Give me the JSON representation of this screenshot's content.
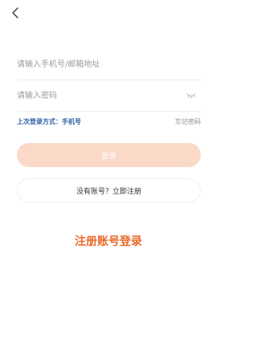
{
  "header": {
    "back_icon": "chevron-left-icon"
  },
  "form": {
    "phone_placeholder": "请输入手机号/邮箱地址",
    "phone_value": "",
    "password_placeholder": "请输入密码",
    "password_value": "",
    "password_toggle_icon": "eye-closed-icon"
  },
  "meta": {
    "last_login_text": "上次登录方式：手机号",
    "forgot_password_label": "忘记密码"
  },
  "actions": {
    "login_label": "登录",
    "register_label": "没有账号？立即注册",
    "register_login_label": "注册账号登录"
  },
  "colors": {
    "accent": "#e8692c",
    "login_button_disabled": "#fbd9c8",
    "link_blue": "#2c5fa3"
  }
}
